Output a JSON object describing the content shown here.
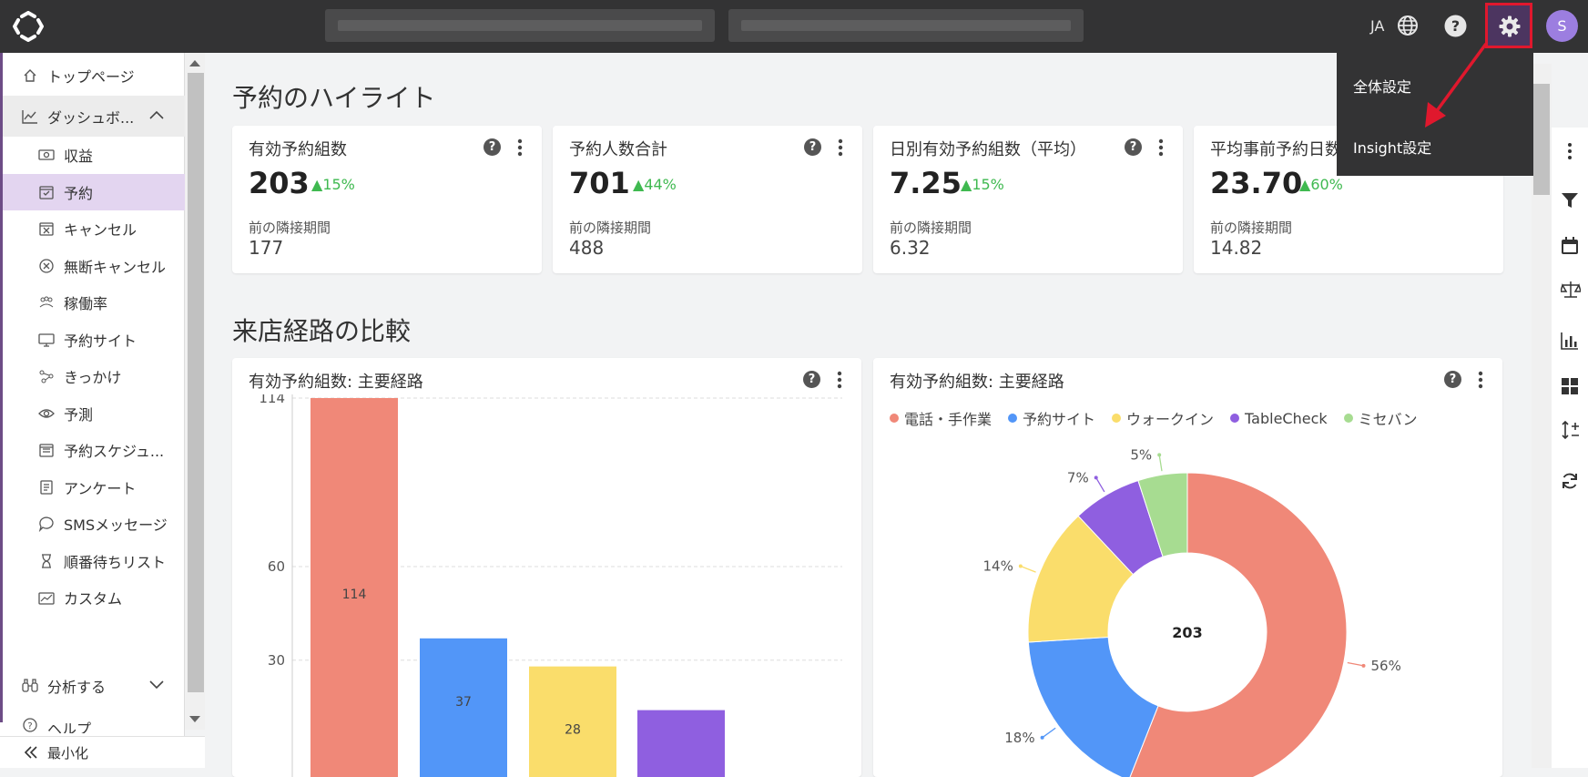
{
  "topbar": {
    "lang": "JA",
    "avatar_initial": "S"
  },
  "settings_menu": {
    "items": [
      "全体設定",
      "Insight設定"
    ]
  },
  "sidebar": {
    "top_page": "トップページ",
    "dashboard": "ダッシュボ...",
    "sub_items": [
      "収益",
      "予約",
      "キャンセル",
      "無断キャンセル",
      "稼働率",
      "予約サイト",
      "きっかけ",
      "予測",
      "予約スケジュ...",
      "アンケート",
      "SMSメッセージ",
      "順番待ちリスト",
      "カスタム"
    ],
    "analyze": "分析する",
    "help": "ヘルプ",
    "minimize": "最小化"
  },
  "highlights": {
    "title": "予約のハイライト",
    "prev_label": "前の隣接期間",
    "cards": [
      {
        "title": "有効予約組数",
        "value": "203",
        "delta": "15%",
        "prev": "177"
      },
      {
        "title": "予約人数合計",
        "value": "701",
        "delta": "44%",
        "prev": "488"
      },
      {
        "title": "日別有効予約組数（平均）",
        "value": "7.25",
        "delta": "15%",
        "prev": "6.32"
      },
      {
        "title": "平均事前予約日数",
        "value": "23.70",
        "delta": "60%",
        "prev": "14.82"
      }
    ]
  },
  "comparison": {
    "title": "来店経路の比較"
  },
  "colors": {
    "phone": "#f08878",
    "site": "#5296f8",
    "walkin": "#fadd6b",
    "tablecheck": "#8f5fe0",
    "misebaan": "#a7dc91"
  },
  "chart_data": [
    {
      "type": "bar",
      "title": "有効予約組数: 主要経路",
      "categories": [
        "電話・手作業",
        "予約サイト",
        "ウォークイン",
        "TableCheck"
      ],
      "values": [
        114,
        37,
        28,
        14
      ],
      "yticks": [
        "114",
        "60",
        "30"
      ],
      "ylim": [
        0,
        114
      ]
    },
    {
      "type": "pie",
      "title": "有効予約組数: 主要経路",
      "center_label": "203",
      "legend": [
        "電話・手作業",
        "予約サイト",
        "ウォークイン",
        "TableCheck",
        "ミセバン"
      ],
      "percents": [
        56,
        18,
        14,
        7,
        5
      ],
      "percent_labels": [
        "56%",
        "18%",
        "14%",
        "7%",
        "5%"
      ]
    }
  ]
}
